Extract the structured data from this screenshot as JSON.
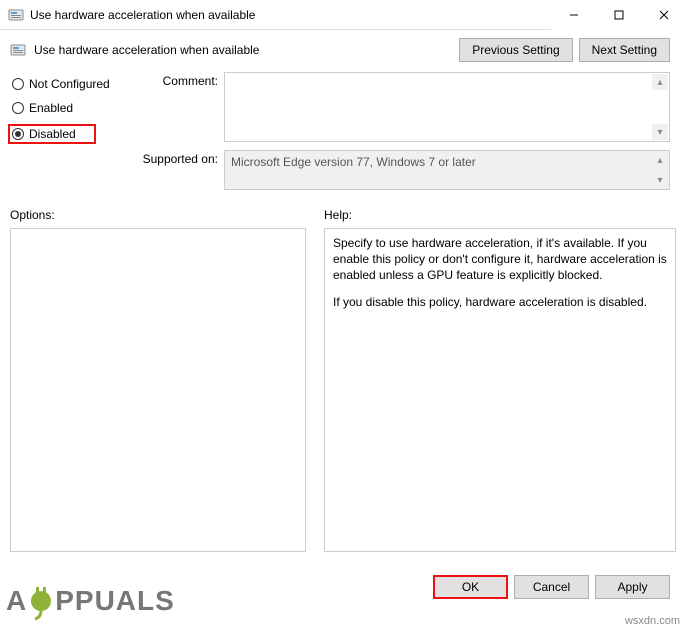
{
  "window": {
    "title": "Use hardware acceleration when available"
  },
  "header": {
    "policy_title": "Use hardware acceleration when available",
    "previous_setting": "Previous Setting",
    "next_setting": "Next Setting"
  },
  "radios": {
    "not_configured": "Not Configured",
    "enabled": "Enabled",
    "disabled": "Disabled",
    "selected": "disabled"
  },
  "fields": {
    "comment_label": "Comment:",
    "comment_value": "",
    "supported_label": "Supported on:",
    "supported_value": "Microsoft Edge version 77, Windows 7 or later"
  },
  "sections": {
    "options_label": "Options:",
    "help_label": "Help:"
  },
  "help": {
    "p1": "Specify to use hardware acceleration, if it's available. If you enable this policy or don't configure it, hardware acceleration is enabled unless a GPU feature is explicitly blocked.",
    "p2": "If you disable this policy, hardware acceleration is disabled."
  },
  "footer": {
    "ok": "OK",
    "cancel": "Cancel",
    "apply": "Apply"
  },
  "watermark": {
    "brand_pre": "A",
    "brand_post": "PPUALS",
    "site": "wsxdn.com"
  }
}
